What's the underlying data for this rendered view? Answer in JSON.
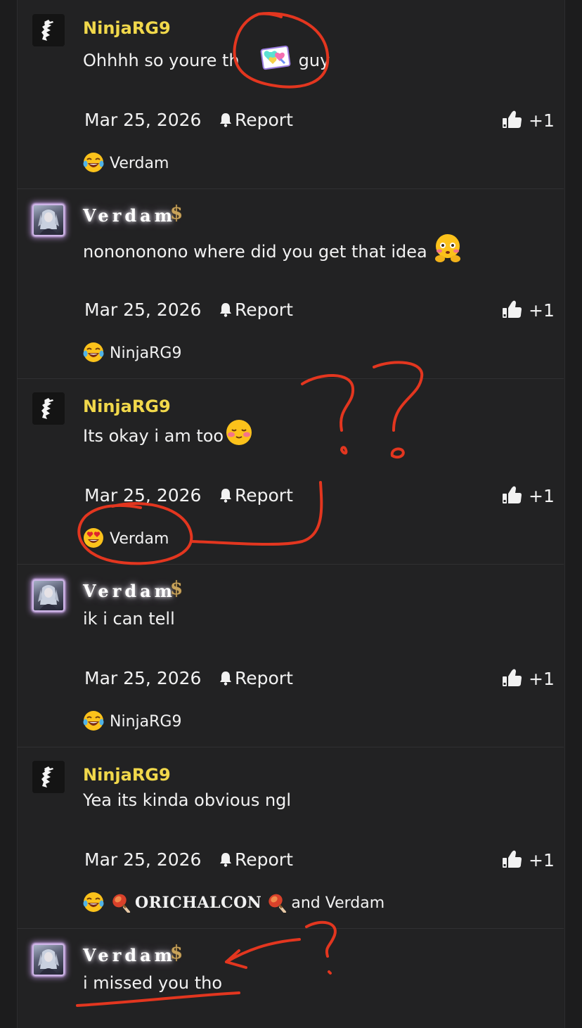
{
  "colors": {
    "background": "#1c1c1d",
    "panel": "#222223",
    "ninja_name": "#f1d84b",
    "text": "#f2f2f2",
    "annotation": "#e3361f"
  },
  "posts": [
    {
      "username": "NinjaRG9",
      "avatar": "ninja-avatar",
      "message": "Ohhhh so youre th",
      "message_tail": "guy",
      "message_emoji": "rainbow-hearts-sticker",
      "date": "Mar 25, 2026",
      "report_label": "Report",
      "likes": "+1",
      "reaction_emoji": "laughing-crying-emoji",
      "reaction_users": "Verdam"
    },
    {
      "username": "Verdam",
      "avatar": "verdam-avatar",
      "badge": "$",
      "message": "nonononono where did you get that idea",
      "message_emoji": "blushing-hands-emoji",
      "date": "Mar 25, 2026",
      "report_label": "Report",
      "likes": "+1",
      "reaction_emoji": "laughing-crying-emoji",
      "reaction_users": "NinjaRG9"
    },
    {
      "username": "NinjaRG9",
      "avatar": "ninja-avatar",
      "message": "Its okay i am too",
      "message_emoji": "relieved-blush-emoji",
      "date": "Mar 25, 2026",
      "report_label": "Report",
      "likes": "+1",
      "reaction_emoji": "heart-eyes-emoji",
      "reaction_users": "Verdam"
    },
    {
      "username": "Verdam",
      "avatar": "verdam-avatar",
      "badge": "$",
      "message": "ik i can tell",
      "date": "Mar 25, 2026",
      "report_label": "Report",
      "likes": "+1",
      "reaction_emoji": "laughing-crying-emoji",
      "reaction_users": "NinjaRG9"
    },
    {
      "username": "NinjaRG9",
      "avatar": "ninja-avatar",
      "message": "Yea its kinda obvious ngl",
      "date": "Mar 25, 2026",
      "report_label": "Report",
      "likes": "+1",
      "reaction_emoji": "laughing-crying-emoji",
      "reaction_torch_icon": "torch-icon",
      "reaction_badge_name": "ORICHALCON",
      "reaction_users_tail": "and Verdam"
    },
    {
      "username": "Verdam",
      "avatar": "verdam-avatar",
      "badge": "$",
      "message": "i missed you tho"
    }
  ]
}
